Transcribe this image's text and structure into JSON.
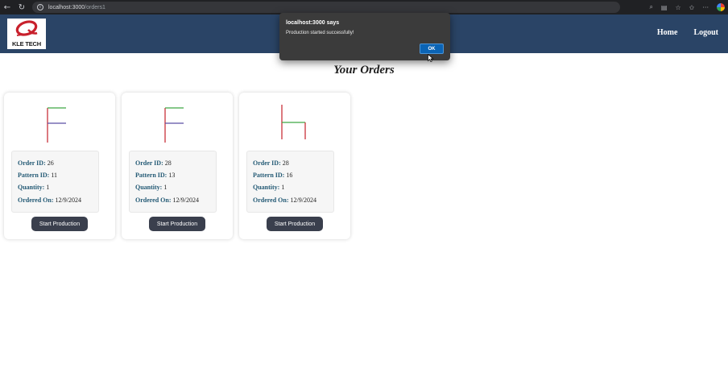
{
  "browser": {
    "url_host": "localhost:3000",
    "url_path": "/orders1"
  },
  "header": {
    "logo_text": "KLE TECH",
    "nav": [
      "Home",
      "Logout"
    ]
  },
  "page": {
    "title": "Your Orders"
  },
  "labels": {
    "order_id": "Order ID:",
    "pattern_id": "Pattern ID:",
    "quantity": "Quantity:",
    "ordered_on": "Ordered On:"
  },
  "orders": [
    {
      "order_id": "26",
      "pattern_id": "11",
      "quantity": "1",
      "ordered_on": "12/9/2024",
      "button": "Start Production"
    },
    {
      "order_id": "28",
      "pattern_id": "13",
      "quantity": "1",
      "ordered_on": "12/9/2024",
      "button": "Start Production"
    },
    {
      "order_id": "28",
      "pattern_id": "16",
      "quantity": "1",
      "ordered_on": "12/9/2024",
      "button": "Start Production"
    }
  ],
  "dialog": {
    "title": "localhost:3000 says",
    "message": "Production started successfully!",
    "ok_label": "OK"
  },
  "colors": {
    "header_bg": "#2a4466",
    "button_bg": "#3a3f4d",
    "label_color": "#245a75",
    "dialog_bg": "#3b3b3b",
    "ok_button": "#0b64b5",
    "pattern_red": "#c8313a",
    "pattern_green": "#3fa845",
    "pattern_purple": "#5b4fa3"
  }
}
